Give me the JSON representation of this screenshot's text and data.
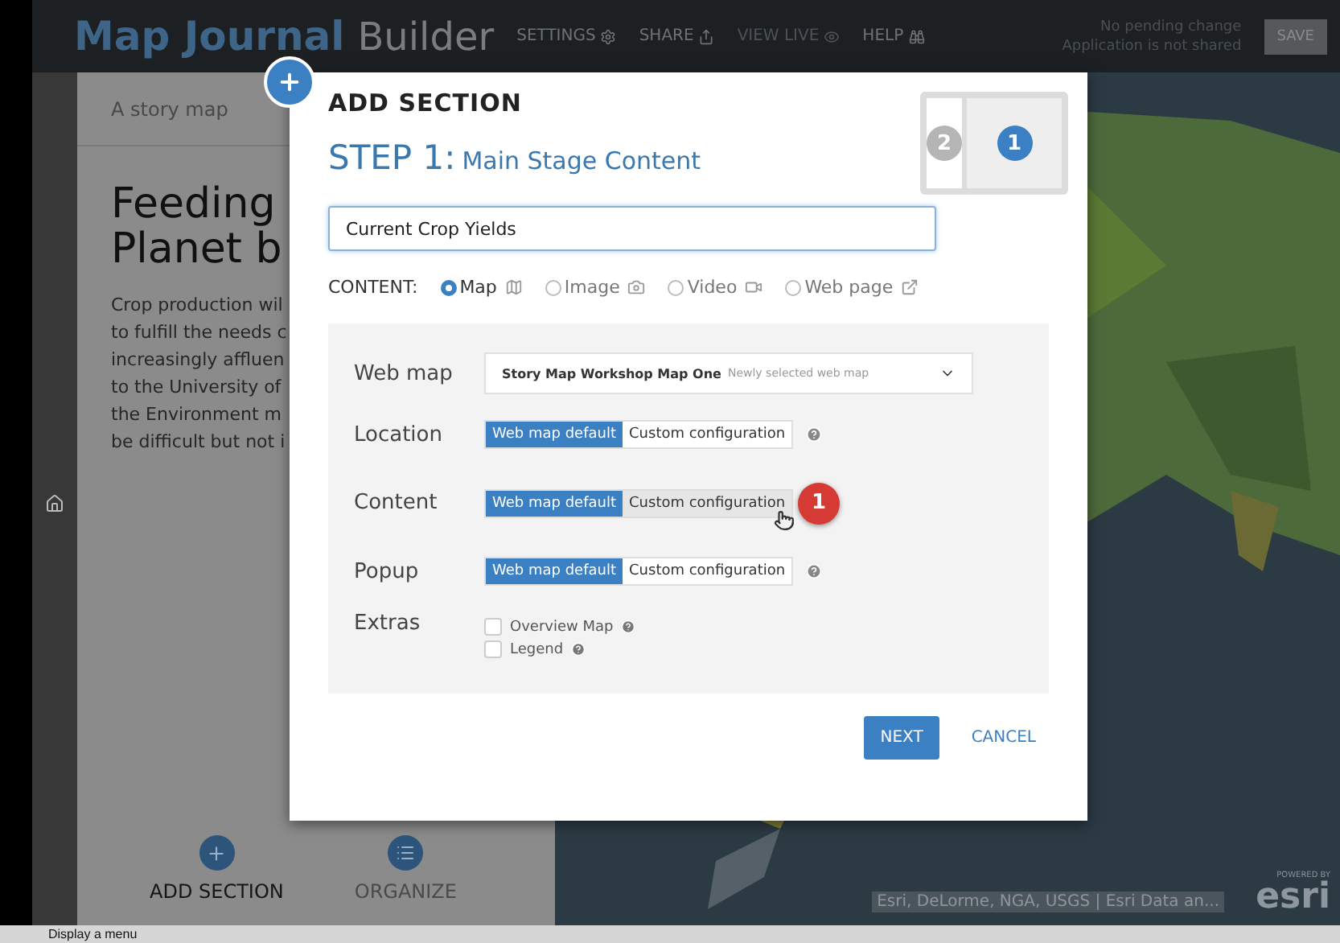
{
  "top_bar": {
    "title": "Map Journal",
    "subtitle": "Builder",
    "menu": [
      {
        "label": "SETTINGS",
        "disabled": false
      },
      {
        "label": "SHARE",
        "disabled": false
      },
      {
        "label": "VIEW LIVE",
        "disabled": true
      },
      {
        "label": "HELP",
        "disabled": false
      }
    ],
    "status_lines": [
      "No pending change",
      "Application is not shared"
    ],
    "save_button": "SAVE"
  },
  "panel": {
    "subtitle": "A story map",
    "heading_lines": [
      "Feeding",
      "Planet b"
    ],
    "body_lines": [
      "Crop production wil",
      "to fulfill the needs c",
      "increasingly affluen",
      "to the University of",
      "the Environment m",
      "be difficult but not i"
    ],
    "actions": [
      {
        "label": "ADD SECTION",
        "active": true
      },
      {
        "label": "ORGANIZE",
        "active": false
      }
    ]
  },
  "map": {
    "attribution": "Esri, DeLorme, NGA, USGS | Esri Data an...",
    "logo_caption": "POWERED BY",
    "logo": "esri"
  },
  "dialog": {
    "title": "ADD SECTION",
    "step": "STEP 1:",
    "step_title": "Main Stage Content",
    "steps": [
      {
        "label": "2",
        "selected": false
      },
      {
        "label": "1",
        "selected": true
      }
    ],
    "title_field": {
      "value": "Current Crop Yields"
    },
    "content_label": "CONTENT:",
    "content_types": [
      {
        "label": "Map",
        "selected": true
      },
      {
        "label": "Image",
        "selected": false
      },
      {
        "label": "Video",
        "selected": false
      },
      {
        "label": "Web page",
        "selected": false
      }
    ],
    "web_map": {
      "label": "Web map",
      "value": "Story Map Workshop Map One",
      "note": "Newly selected web map"
    },
    "options": [
      {
        "label": "Location",
        "help": true,
        "choices": [
          {
            "label": "Web map default",
            "selected": true
          },
          {
            "label": "Custom configuration",
            "selected": false
          }
        ]
      },
      {
        "label": "Content",
        "badge": "1",
        "choices": [
          {
            "label": "Web map default",
            "selected": true
          },
          {
            "label": "Custom configuration",
            "selected": false
          }
        ]
      },
      {
        "label": "Popup",
        "help": true,
        "choices": [
          {
            "label": "Web map default",
            "selected": true
          },
          {
            "label": "Custom configuration",
            "selected": false
          }
        ]
      }
    ],
    "extras": {
      "label": "Extras",
      "items": [
        {
          "label": "Overview Map",
          "checked": false
        },
        {
          "label": "Legend",
          "checked": false
        }
      ]
    },
    "buttons": {
      "next": "NEXT",
      "cancel": "CANCEL"
    }
  },
  "status_bar": "Display a menu"
}
